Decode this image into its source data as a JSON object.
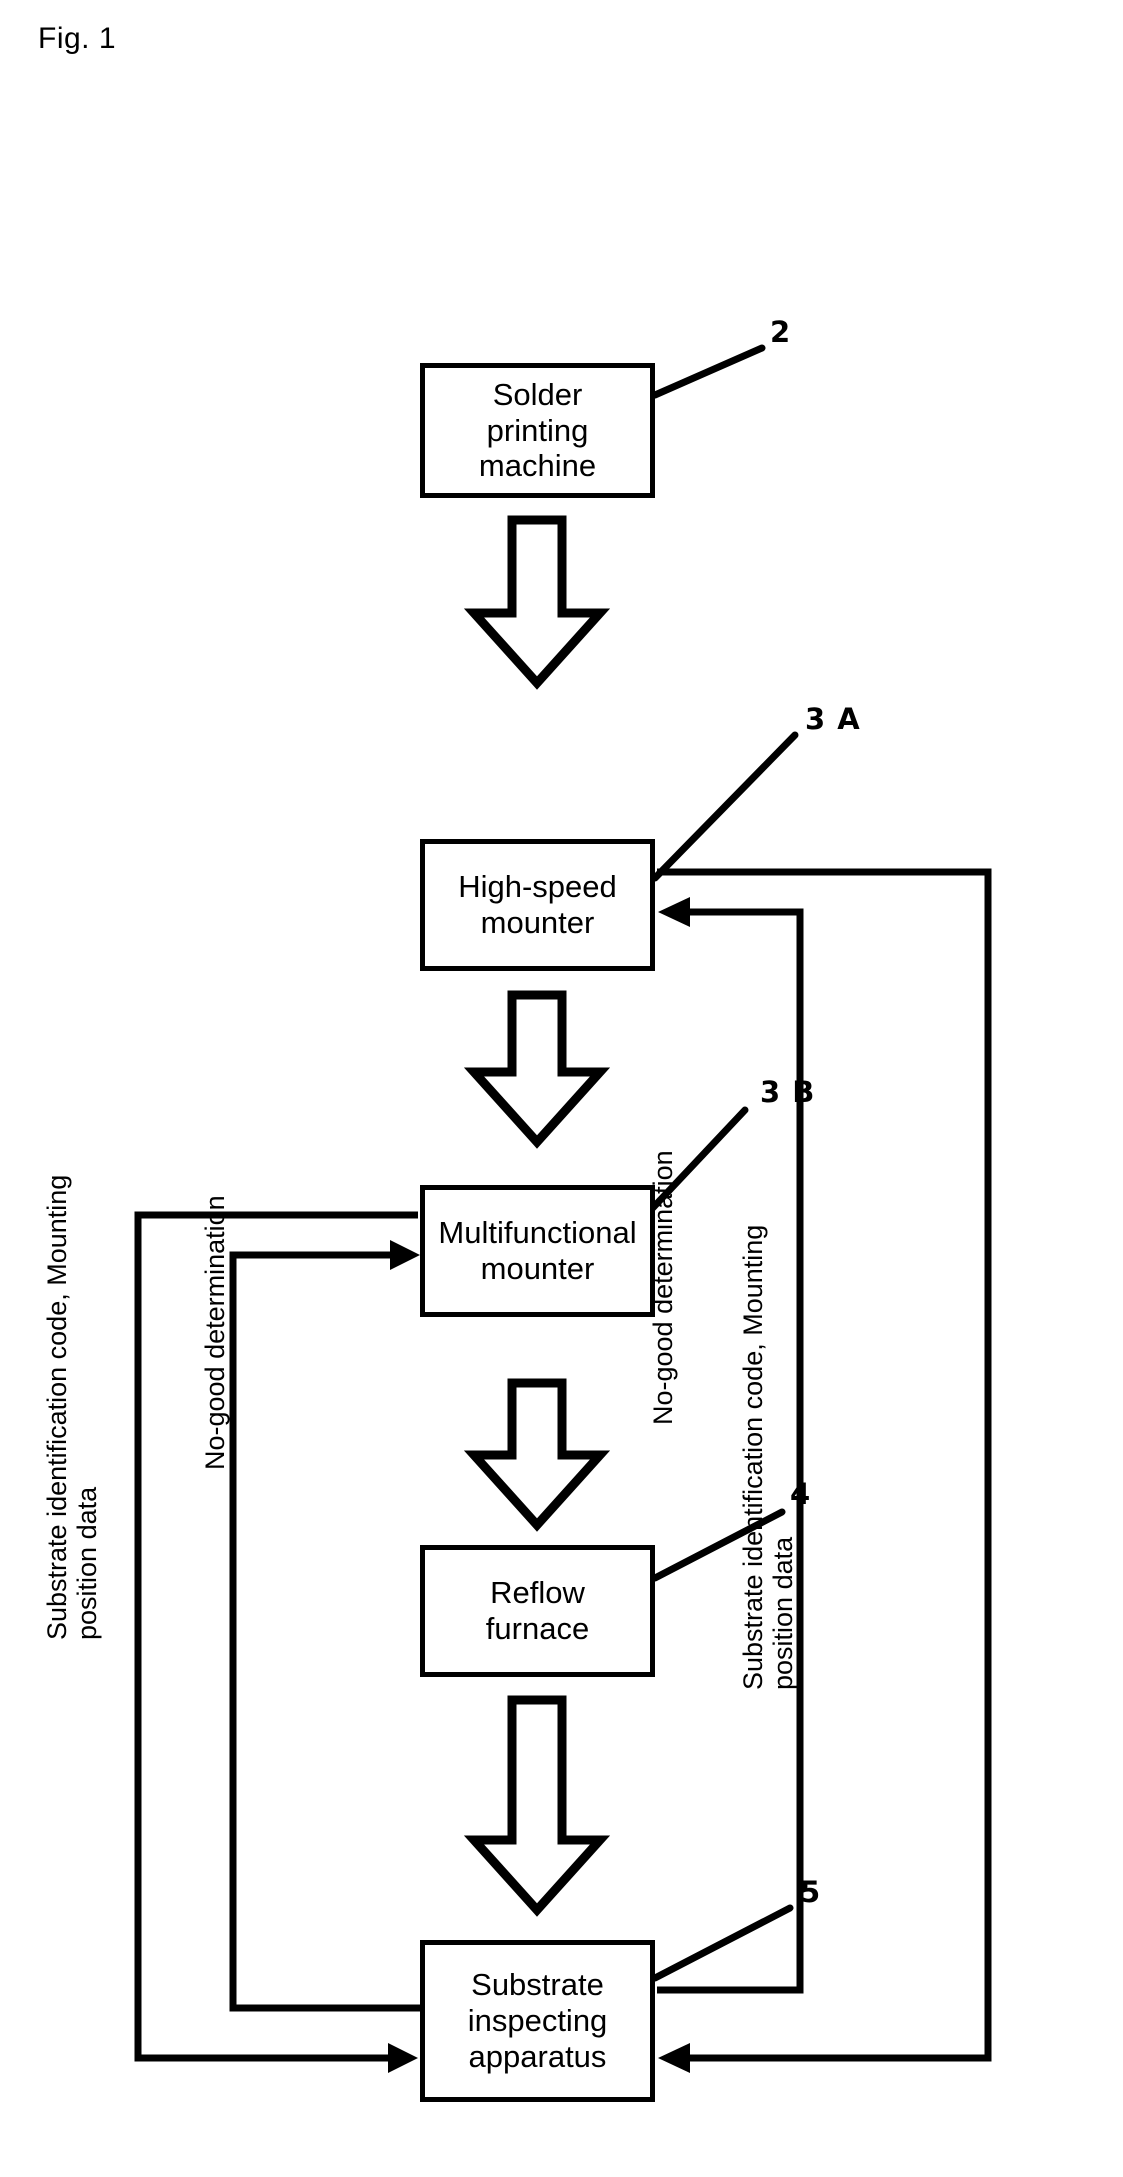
{
  "figure": {
    "caption": "Fig. 1",
    "type": "patent-flow-diagram"
  },
  "nodes": [
    {
      "id": "solder",
      "label": "Solder\nprinting\nmachine",
      "ref": "2"
    },
    {
      "id": "highspeed",
      "label": "High-speed\nmounter",
      "ref": "3 A"
    },
    {
      "id": "multifunc",
      "label": "Multifunctional\nmounter",
      "ref": "3 B"
    },
    {
      "id": "reflow",
      "label": "Reflow\nfurnace",
      "ref": "4"
    },
    {
      "id": "inspect",
      "label": "Substrate\ninspecting\napparatus",
      "ref": "5"
    }
  ],
  "flow_arrows": [
    {
      "from": "solder",
      "to": "highspeed",
      "style": "block-arrow-down"
    },
    {
      "from": "highspeed",
      "to": "multifunc",
      "style": "block-arrow-down"
    },
    {
      "from": "multifunc",
      "to": "reflow",
      "style": "block-arrow-down"
    },
    {
      "from": "reflow",
      "to": "inspect",
      "style": "block-arrow-down"
    }
  ],
  "feedback_loops": [
    {
      "id": "inner-nogood",
      "label": "No-good determination",
      "from": "inspect",
      "to": "multifunc",
      "side": "left"
    },
    {
      "id": "right-nogood",
      "label": "No-good determination",
      "from": "inspect",
      "to": "highspeed",
      "side": "right"
    },
    {
      "id": "left-substrate-data",
      "label": "Substrate identification code, Mounting\nposition data",
      "from": "multifunc",
      "to": "inspect",
      "side": "far-left"
    },
    {
      "id": "right-substrate-data",
      "label": "Substrate identification code, Mounting\nposition data",
      "from": "highspeed",
      "to": "inspect",
      "side": "far-right"
    }
  ],
  "colors": {
    "ink": "#000000",
    "paper": "#ffffff"
  }
}
